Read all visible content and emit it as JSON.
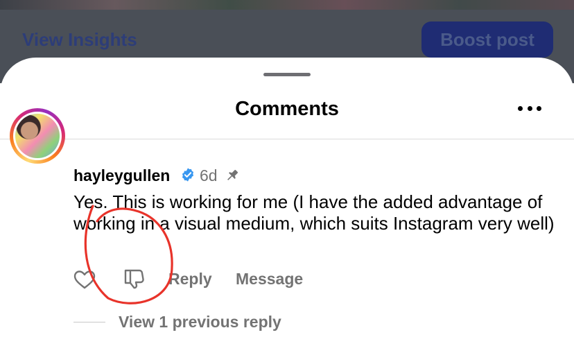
{
  "background": {
    "view_insights_label": "View Insights",
    "boost_post_label": "Boost post"
  },
  "sheet": {
    "title": "Comments",
    "more_icon": "more-horizontal-icon"
  },
  "comment": {
    "username": "hayleygullen",
    "verified": true,
    "timestamp": "6d",
    "pinned": true,
    "text": "Yes. This is working for me (I have the added advantage of working in a visual medium, which suits Instagram very well)",
    "actions": {
      "like_icon": "heart-icon",
      "dislike_icon": "thumbs-down-icon",
      "reply_label": "Reply",
      "message_label": "Message"
    },
    "view_replies_label": "View 1 previous reply"
  },
  "colors": {
    "accent_blue": "#3897f0",
    "secondary_text": "#737373",
    "annotation_red": "#e8332a"
  }
}
